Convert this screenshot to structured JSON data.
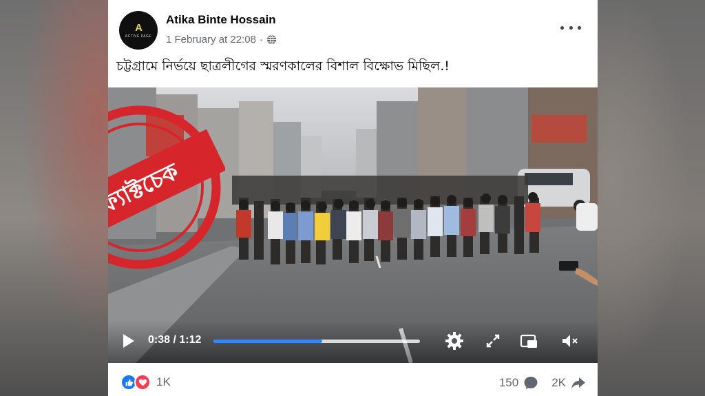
{
  "post": {
    "author": "Atika Binte Hossain",
    "timestamp": "1 February at 22:08",
    "separator": "·",
    "avatar_text": "ACTIVE PAGE",
    "avatar_mark": "A",
    "caption": "চট্টগ্রামে নির্ভয়ে ছাত্রলীগের স্মরণকালের বিশাল বিক্ষোভ মিছিল.!"
  },
  "video": {
    "current_time": "0:38",
    "duration": "1:12",
    "time_display": "0:38 / 1:12",
    "progress": 0.527
  },
  "stamp": {
    "text": "ফ্যাক্টচেক",
    "color": "#d7262b"
  },
  "footer": {
    "reaction_count": "1K",
    "comment_count": "150",
    "share_count": "2K"
  },
  "icons": [
    "globe-icon",
    "more-options-icon",
    "play-icon",
    "settings-icon",
    "fullscreen-icon",
    "picture-in-picture-icon",
    "mute-icon",
    "like-icon",
    "love-icon",
    "comment-icon",
    "share-icon"
  ],
  "colors": {
    "accent": "#2d88ff",
    "like": "#1877f2",
    "love": "#f33e58",
    "text_secondary": "#65676b"
  }
}
